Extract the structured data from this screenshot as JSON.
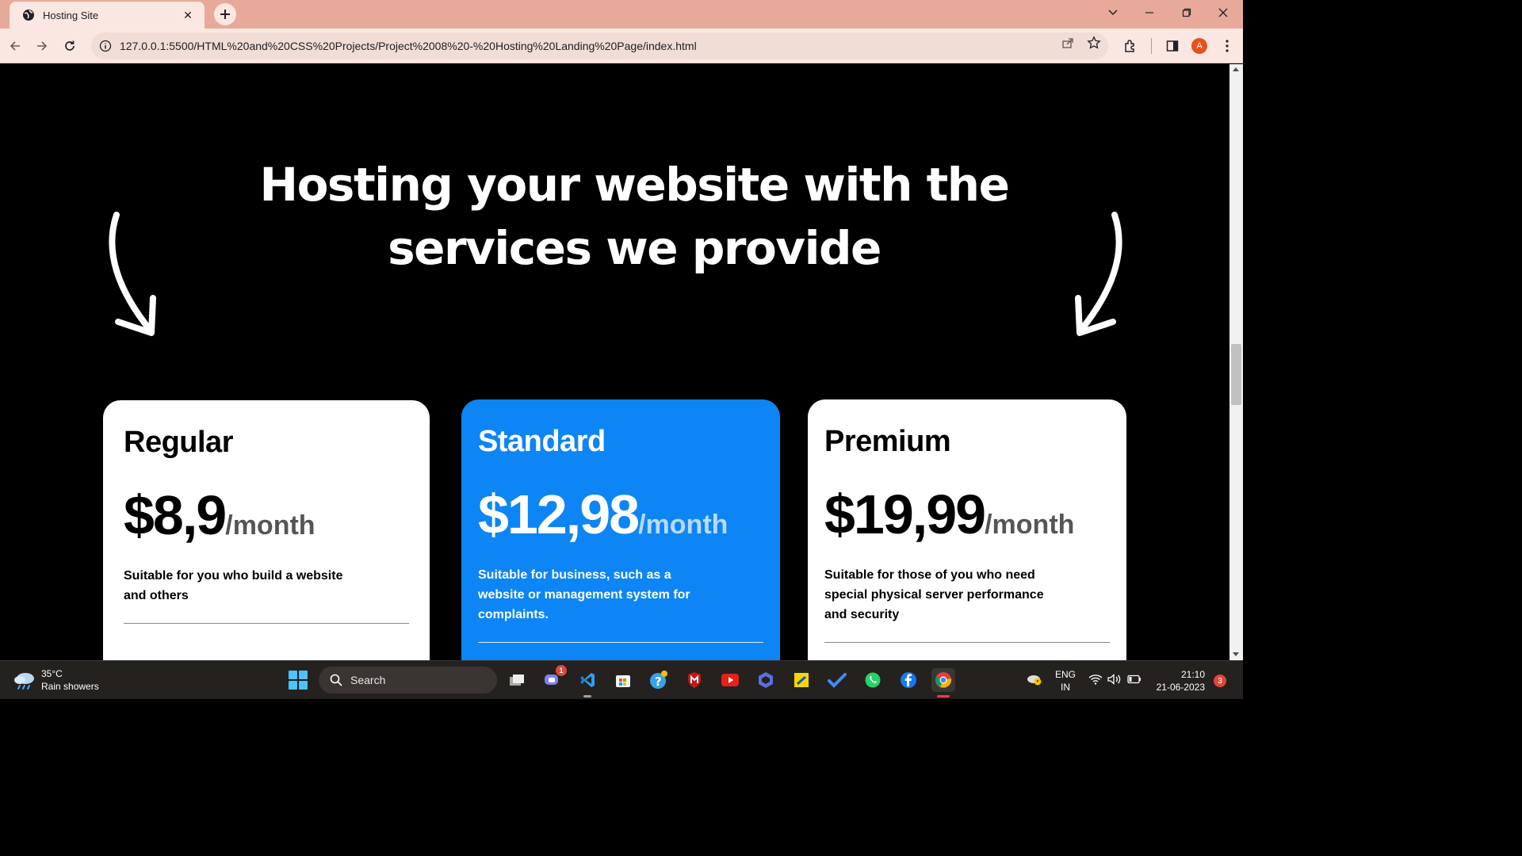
{
  "browser": {
    "tab_title": "Hosting Site",
    "url": "127.0.0.1:5500/HTML%20and%20CSS%20Projects/Project%2008%20-%20Hosting%20Landing%20Page/index.html",
    "profile_initial": "A"
  },
  "page": {
    "heading_line1": "Hosting your website with the",
    "heading_line2": "services we provide",
    "plans": [
      {
        "name": "Regular",
        "price": "$8,9",
        "period": "/month",
        "desc": "Suitable for you who build a website and others"
      },
      {
        "name": "Standard",
        "price": "$12,98",
        "period": "/month",
        "desc": "Suitable for business, such as a website or management system for complaints."
      },
      {
        "name": "Premium",
        "price": "$19,99",
        "period": "/month",
        "desc": "Suitable for those of you who need special physical server performance and security"
      }
    ],
    "colors": {
      "background": "#000000",
      "featured_card": "#0d85f5",
      "card": "#ffffff"
    }
  },
  "taskbar": {
    "weather_temp": "35°C",
    "weather_desc": "Rain showers",
    "search_placeholder": "Search",
    "teams_badge": "1",
    "lang_line1": "ENG",
    "lang_line2": "IN",
    "time": "21:10",
    "date": "21-06-2023",
    "notification_count": "3"
  }
}
